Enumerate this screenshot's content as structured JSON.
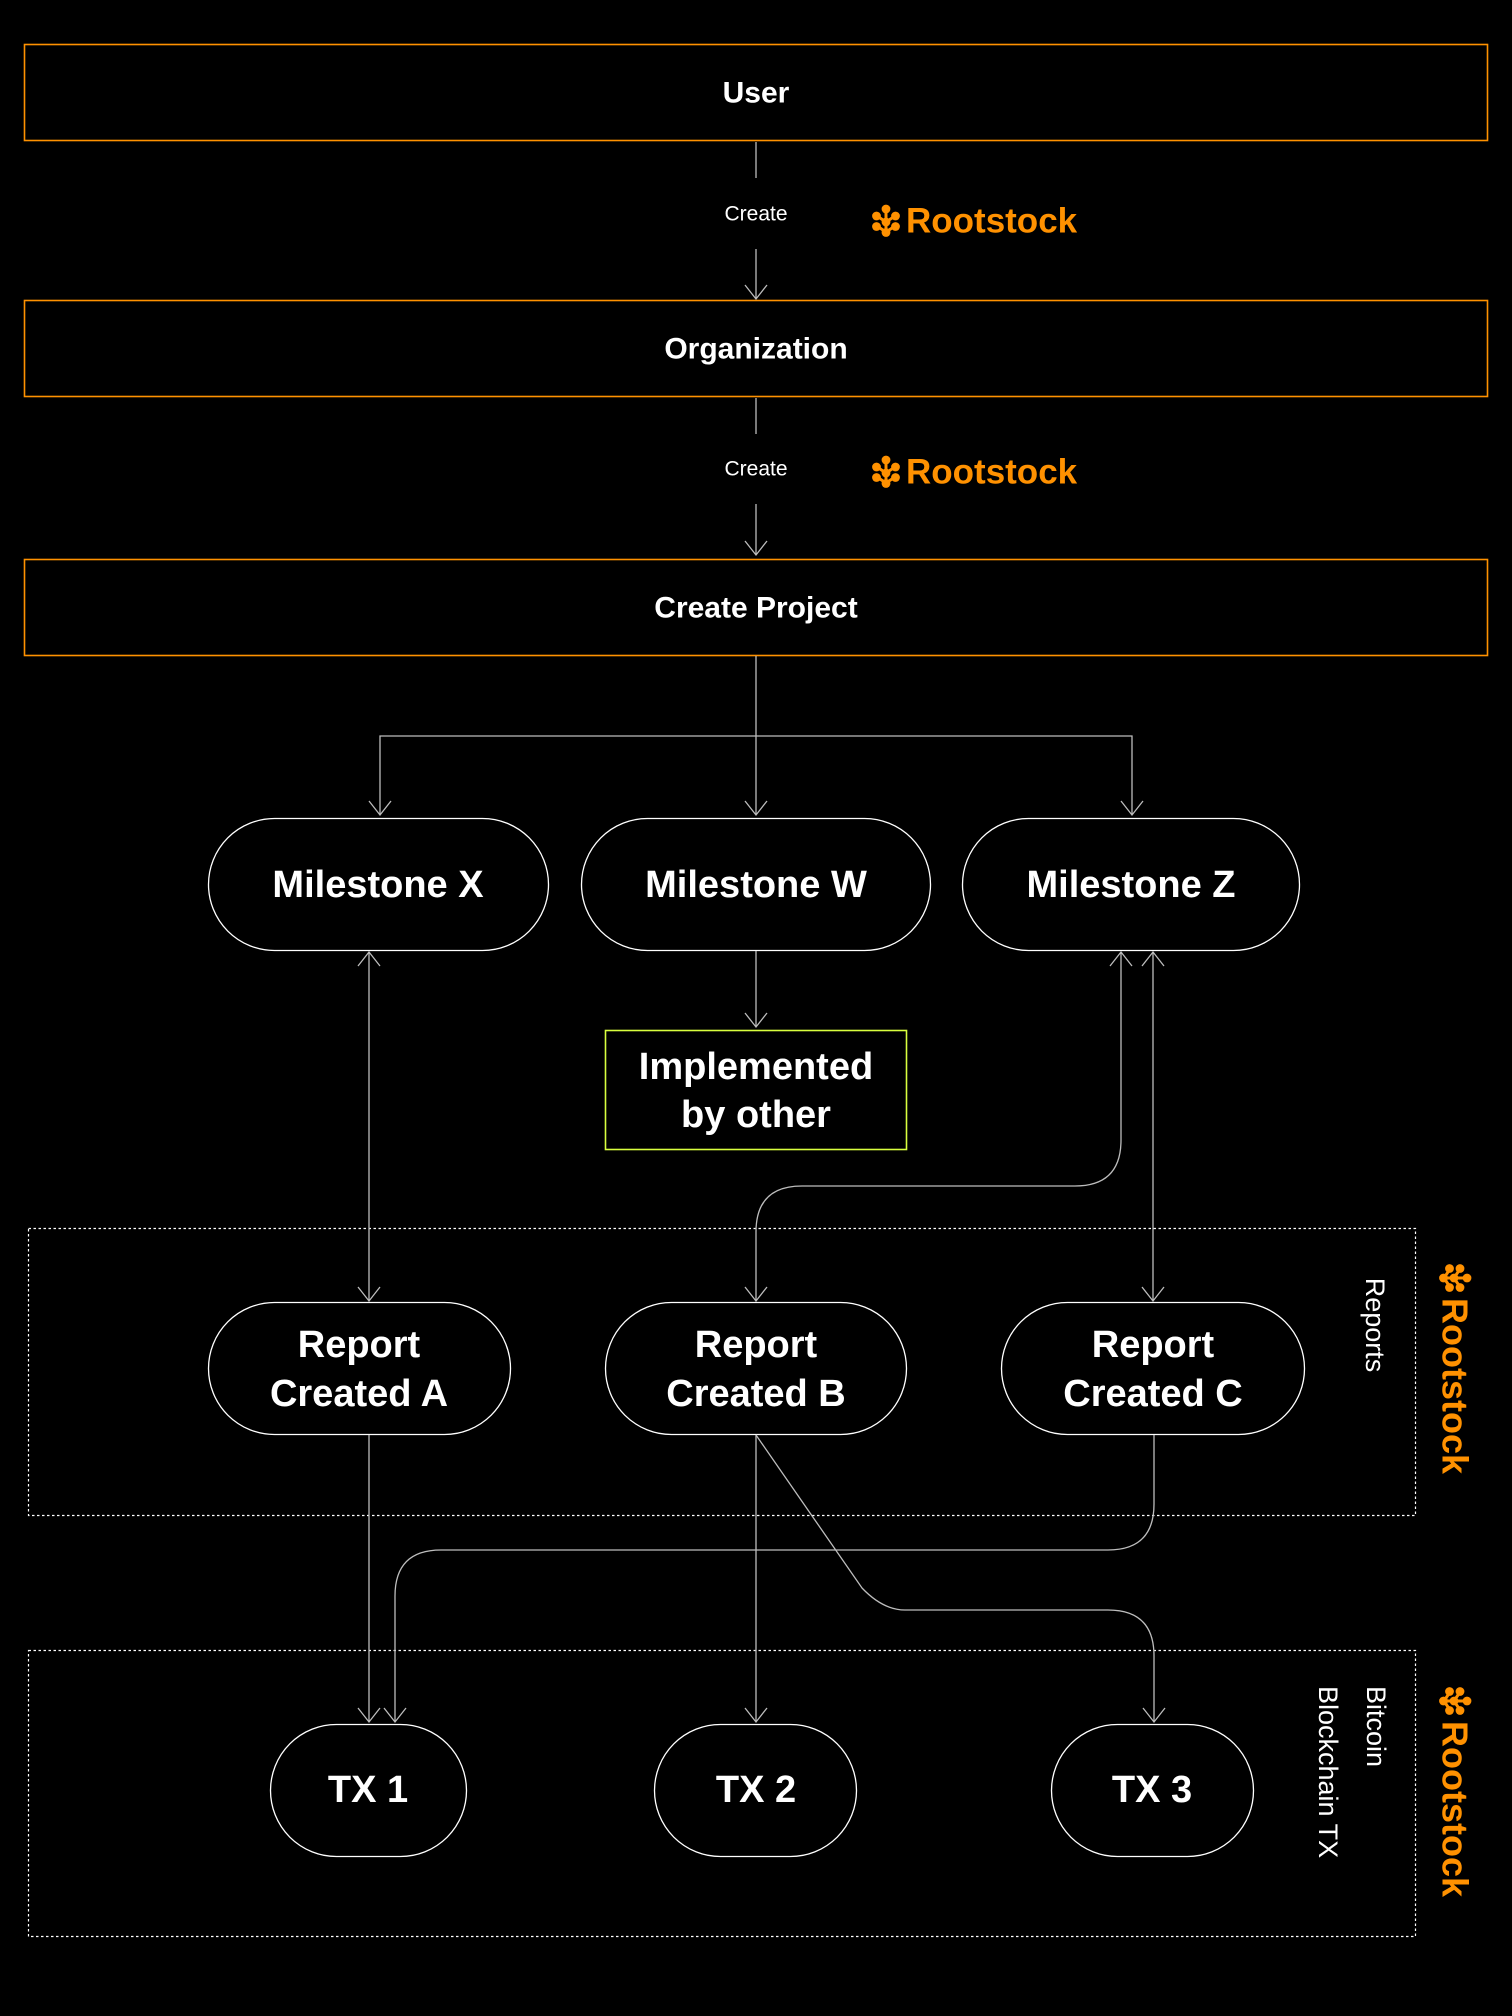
{
  "colors": {
    "background": "#000000",
    "accent_orange": "#FF9100",
    "highlight_green": "#D9FF3F",
    "node_stroke": "#FFFFFF",
    "connector": "#BDBDBD",
    "group_border": "#FFFFFF"
  },
  "brand": {
    "name": "Rootstock",
    "icon": "rootstock-logo-icon"
  },
  "stages": [
    {
      "id": "user",
      "label": "User"
    },
    {
      "id": "organization",
      "label": "Organization"
    },
    {
      "id": "create_project",
      "label": "Create Project"
    }
  ],
  "stage_links": [
    {
      "label": "Create",
      "brand": "Rootstock"
    },
    {
      "label": "Create",
      "brand": "Rootstock"
    }
  ],
  "milestones": [
    {
      "id": "x",
      "label": "Milestone X"
    },
    {
      "id": "w",
      "label": "Milestone W"
    },
    {
      "id": "z",
      "label": "Milestone Z"
    }
  ],
  "external_note": {
    "line1": "Implemented",
    "line2": "by other"
  },
  "groups": {
    "reports": {
      "label": "Reports",
      "brand": "Rootstock"
    },
    "transactions": {
      "label_line1": "Bitcoin",
      "label_line2": "Blockchain TX",
      "brand": "Rootstock"
    }
  },
  "reports": [
    {
      "id": "a",
      "line1": "Report",
      "line2": "Created A"
    },
    {
      "id": "b",
      "line1": "Report",
      "line2": "Created B"
    },
    {
      "id": "c",
      "line1": "Report",
      "line2": "Created C"
    }
  ],
  "transactions": [
    {
      "id": "tx1",
      "label": "TX 1"
    },
    {
      "id": "tx2",
      "label": "TX 2"
    },
    {
      "id": "tx3",
      "label": "TX 3"
    }
  ],
  "edges": [
    {
      "from": "User",
      "to": "Organization",
      "label": "Create"
    },
    {
      "from": "Organization",
      "to": "Create Project",
      "label": "Create"
    },
    {
      "from": "Create Project",
      "to": "Milestone X"
    },
    {
      "from": "Create Project",
      "to": "Milestone W"
    },
    {
      "from": "Create Project",
      "to": "Milestone Z"
    },
    {
      "from": "Milestone W",
      "to": "Implemented by other"
    },
    {
      "from": "Milestone X",
      "to": "Report Created A",
      "bidirectional": true
    },
    {
      "from": "Report Created B",
      "to": "Milestone Z"
    },
    {
      "from": "Milestone Z",
      "to": "Report Created C",
      "bidirectional": true
    },
    {
      "from": "Report Created A",
      "to": "TX 1"
    },
    {
      "from": "Report Created C",
      "to": "TX 1"
    },
    {
      "from": "Report Created B",
      "to": "TX 2"
    },
    {
      "from": "Report Created B",
      "to": "TX 3"
    }
  ]
}
